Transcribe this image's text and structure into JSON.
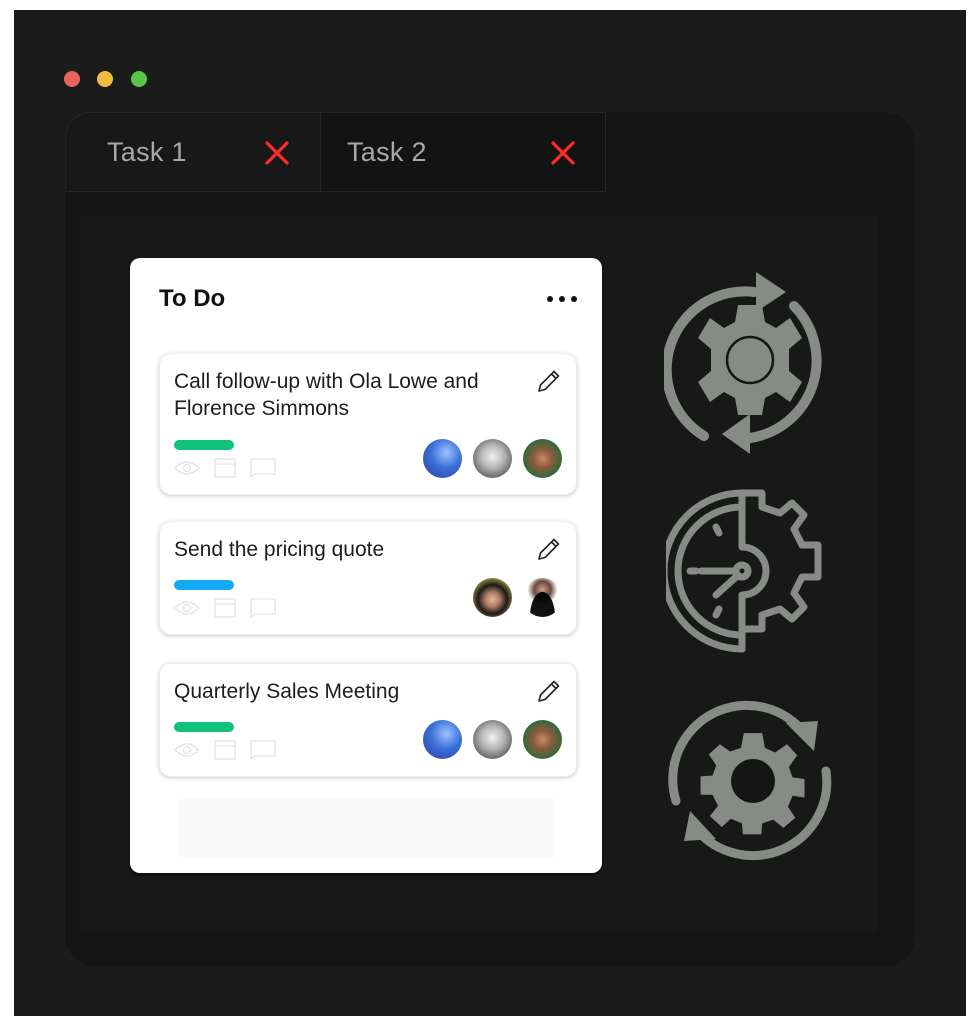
{
  "window": {
    "controls": [
      {
        "name": "close",
        "color": "#e8655c"
      },
      {
        "name": "minimize",
        "color": "#f1bb42"
      },
      {
        "name": "maximize",
        "color": "#58c54a"
      }
    ]
  },
  "tabs": [
    {
      "label": "Task 1",
      "close_icon": "x-icon",
      "close_color": "#ff2a2a"
    },
    {
      "label": "Task 2",
      "close_icon": "x-icon",
      "close_color": "#ff2a2a"
    }
  ],
  "board": {
    "title": "To Do",
    "menu_icon": "more-horizontal-icon",
    "cards": [
      {
        "title": "Call follow-up with Ola Lowe and Florence Simmons",
        "label_color": "#11c27a",
        "icons": [
          "eye-icon",
          "calendar-icon",
          "comment-icon"
        ],
        "avatars": [
          "avatar-blue-figure",
          "avatar-bw-man",
          "avatar-smiling-man"
        ]
      },
      {
        "title": "Send the pricing quote",
        "label_color": "#12a9f5",
        "icons": [
          "eye-icon",
          "calendar-icon",
          "comment-icon"
        ],
        "avatars": [
          "avatar-woman",
          "avatar-young-man"
        ]
      },
      {
        "title": "Quarterly Sales Meeting",
        "label_color": "#11c27a",
        "icons": [
          "eye-icon",
          "calendar-icon",
          "comment-icon"
        ],
        "avatars": [
          "avatar-blue-figure",
          "avatar-bw-man",
          "avatar-smiling-man"
        ]
      }
    ]
  },
  "side_icons": [
    "gear-sync-icon",
    "clock-gear-icon",
    "gear-refresh-icon"
  ],
  "colors": {
    "icon_gray": "#868b86",
    "window_bg": "#1b1b1b",
    "panel_bg": "#151515"
  }
}
